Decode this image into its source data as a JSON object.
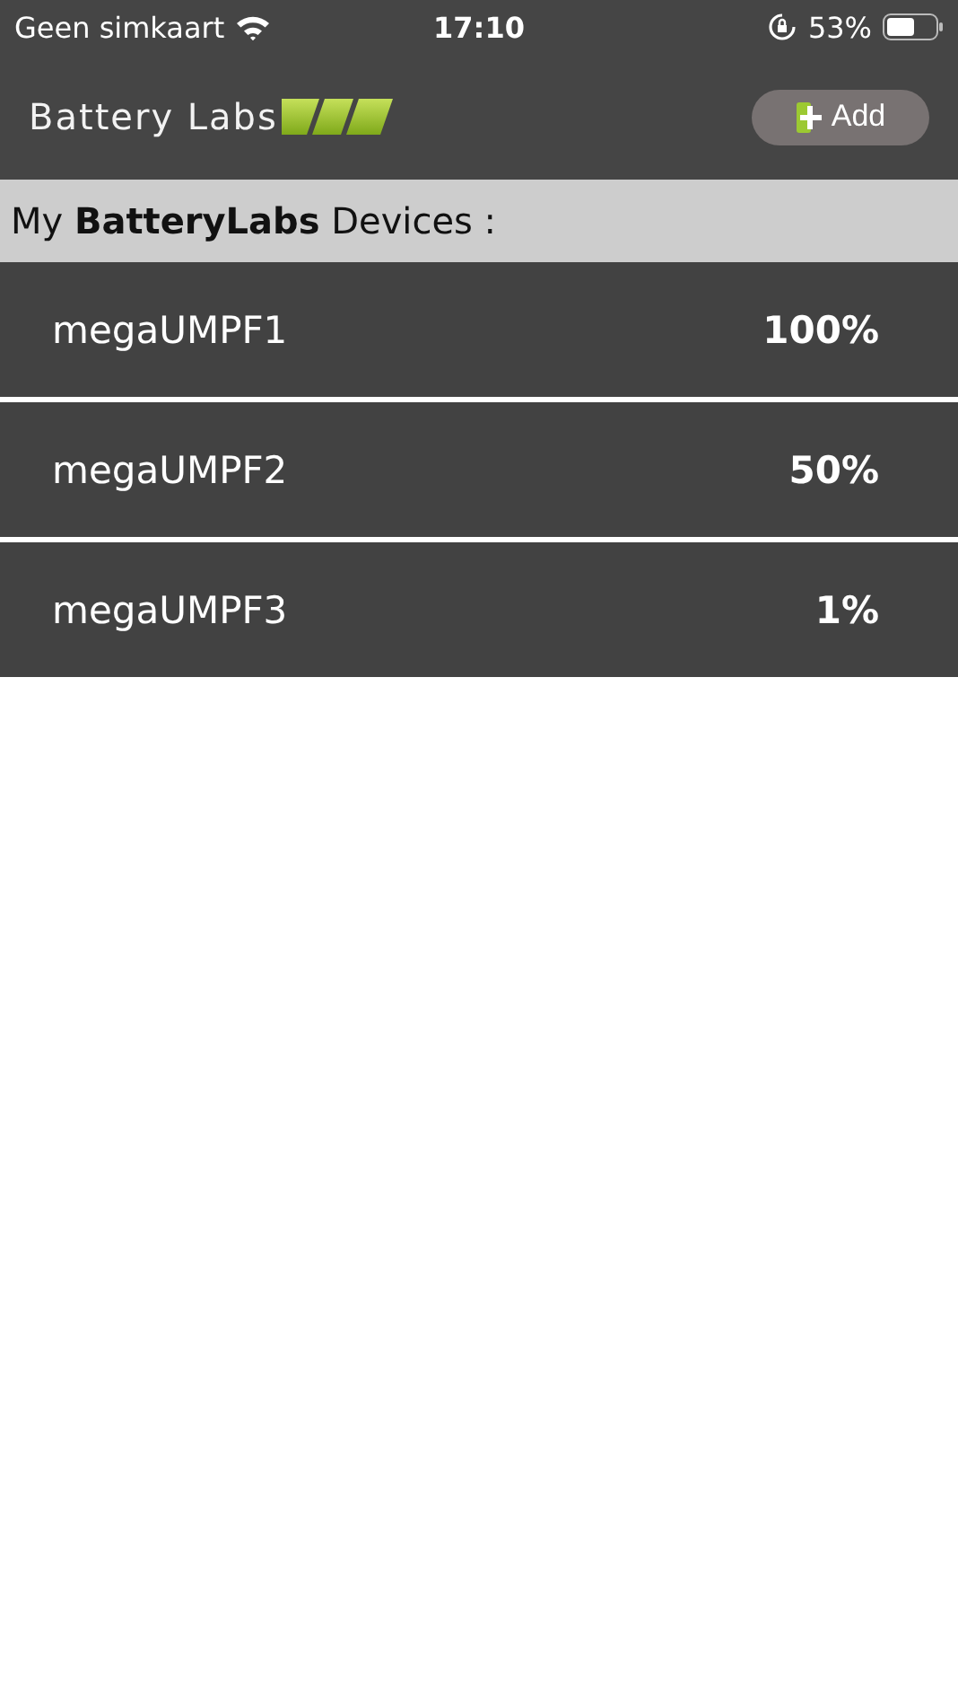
{
  "status_bar": {
    "carrier": "Geen simkaart",
    "time": "17:10",
    "battery_percent": "53%"
  },
  "header": {
    "logo_text": "Battery Labs",
    "add_button": "Add"
  },
  "section_title": "My **BatteryLabs** Devices :",
  "devices": [
    {
      "name": "megaUMPF1",
      "charge": "100%"
    },
    {
      "name": "megaUMPF2",
      "charge": "50%"
    },
    {
      "name": "megaUMPF3",
      "charge": "1%"
    }
  ]
}
